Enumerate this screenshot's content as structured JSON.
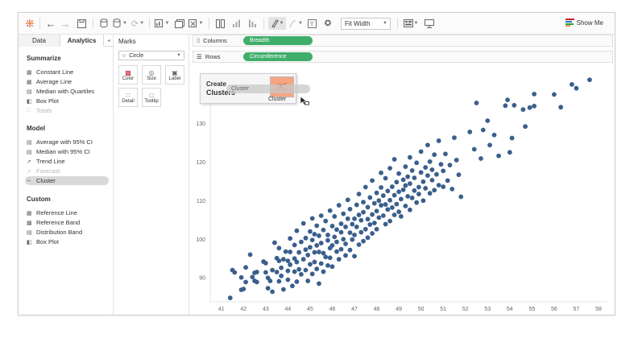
{
  "toolbar": {
    "fit_select": "Fit Width",
    "show_me": "Show Me",
    "icons": [
      "tableau-logo-icon",
      "undo-icon",
      "redo-icon",
      "save-icon",
      "new-datasource-icon",
      "pause-icon",
      "refresh-icon",
      "new-sheet-icon",
      "duplicate-sheet-icon",
      "clear-sheet-icon",
      "swap-icon",
      "sort-ascending-icon",
      "sort-descending-icon",
      "highlight-icon",
      "group-icon",
      "label-icon",
      "pin-icon",
      "fit-icon",
      "presentation-icon",
      "show-me-icon"
    ]
  },
  "left_panel": {
    "tabs": {
      "data": "Data",
      "analytics": "Analytics",
      "collapse": "◂"
    },
    "summarize": {
      "title": "Summarize",
      "items": [
        {
          "label": "Constant Line",
          "icon": "constant-line-icon",
          "enabled": true
        },
        {
          "label": "Average Line",
          "icon": "average-line-icon",
          "enabled": true
        },
        {
          "label": "Median with Quartiles",
          "icon": "median-quartiles-icon",
          "enabled": true
        },
        {
          "label": "Box Plot",
          "icon": "box-plot-icon",
          "enabled": true
        },
        {
          "label": "Totals",
          "icon": "totals-icon",
          "enabled": false
        }
      ]
    },
    "model": {
      "title": "Model",
      "items": [
        {
          "label": "Average with 95% CI",
          "icon": "average-ci-icon",
          "enabled": true
        },
        {
          "label": "Median with 95% CI",
          "icon": "median-ci-icon",
          "enabled": true
        },
        {
          "label": "Trend Line",
          "icon": "trend-line-icon",
          "enabled": true
        },
        {
          "label": "Forecast",
          "icon": "forecast-icon",
          "enabled": false
        },
        {
          "label": "Cluster",
          "icon": "cluster-icon",
          "enabled": true,
          "selected": true
        }
      ]
    },
    "custom": {
      "title": "Custom",
      "items": [
        {
          "label": "Reference Line",
          "icon": "reference-line-icon",
          "enabled": true
        },
        {
          "label": "Reference Band",
          "icon": "reference-band-icon",
          "enabled": true
        },
        {
          "label": "Distribution Band",
          "icon": "distribution-band-icon",
          "enabled": true
        },
        {
          "label": "Box Plot",
          "icon": "box-plot-icon",
          "enabled": true
        }
      ]
    }
  },
  "marks": {
    "title": "Marks",
    "type": "Circle",
    "cards": [
      "Color",
      "Size",
      "Label",
      "Detail",
      "Tooltip"
    ]
  },
  "shelves": {
    "columns_label": "Columns",
    "columns_pill": "Breadth",
    "rows_label": "Rows",
    "rows_pill": "Circumference"
  },
  "overlay": {
    "title_line1": "Create",
    "title_line2": "Clusters",
    "drop_label": "Cluster",
    "drag_ghost": "Cluster"
  },
  "colors": {
    "accent_pill": "#3fae6a",
    "mark": "#3b5f8c",
    "drop_target": "#f6a583"
  },
  "chart_data": {
    "type": "scatter",
    "x_ticks": [
      41,
      42,
      43,
      44,
      45,
      46,
      47,
      48,
      49,
      50,
      51,
      52,
      53,
      54,
      55,
      56,
      57,
      58
    ],
    "y_ticks": [
      90,
      100,
      110,
      120,
      130
    ],
    "xlim": [
      40.5,
      58.4
    ],
    "ylim": [
      84,
      143
    ],
    "grid": false,
    "points": [
      [
        41.4,
        84.8
      ],
      [
        41.5,
        92.0
      ],
      [
        41.6,
        91.4
      ],
      [
        41.9,
        90.1
      ],
      [
        41.9,
        86.9
      ],
      [
        42.0,
        87.1
      ],
      [
        42.1,
        88.9
      ],
      [
        42.1,
        92.7
      ],
      [
        42.3,
        96.0
      ],
      [
        42.4,
        90.2
      ],
      [
        42.5,
        89.2
      ],
      [
        42.5,
        91.3
      ],
      [
        42.6,
        88.9
      ],
      [
        42.6,
        91.5
      ],
      [
        42.9,
        94.2
      ],
      [
        43.0,
        93.8
      ],
      [
        43.0,
        91.4
      ],
      [
        43.1,
        90.0
      ],
      [
        43.1,
        87.3
      ],
      [
        43.2,
        89.2
      ],
      [
        43.3,
        92.0
      ],
      [
        43.3,
        86.4
      ],
      [
        43.4,
        99.1
      ],
      [
        43.5,
        91.5
      ],
      [
        43.5,
        95.1
      ],
      [
        43.6,
        89.1
      ],
      [
        43.6,
        97.7
      ],
      [
        43.6,
        94.4
      ],
      [
        43.7,
        92.6
      ],
      [
        43.7,
        90.5
      ],
      [
        43.8,
        94.8
      ],
      [
        43.8,
        87.0
      ],
      [
        43.9,
        96.8
      ],
      [
        44.0,
        94.4
      ],
      [
        44.0,
        91.8
      ],
      [
        44.0,
        89.5
      ],
      [
        44.1,
        100.2
      ],
      [
        44.1,
        96.7
      ],
      [
        44.1,
        93.4
      ],
      [
        44.2,
        87.9
      ],
      [
        44.3,
        95.0
      ],
      [
        44.3,
        91.6
      ],
      [
        44.3,
        98.5
      ],
      [
        44.4,
        89.0
      ],
      [
        44.4,
        102.2
      ],
      [
        44.4,
        94.1
      ],
      [
        44.5,
        92.2
      ],
      [
        44.5,
        96.6
      ],
      [
        44.6,
        99.3
      ],
      [
        44.6,
        90.9
      ],
      [
        44.7,
        104.1
      ],
      [
        44.7,
        94.8
      ],
      [
        44.8,
        97.3
      ],
      [
        44.8,
        92.0
      ],
      [
        44.8,
        100.3
      ],
      [
        44.9,
        95.9
      ],
      [
        44.9,
        89.2
      ],
      [
        45.0,
        102.0
      ],
      [
        45.0,
        97.9
      ],
      [
        45.0,
        93.5
      ],
      [
        45.1,
        99.8
      ],
      [
        45.1,
        105.4
      ],
      [
        45.1,
        91.0
      ],
      [
        45.2,
        96.6
      ],
      [
        45.2,
        101.3
      ],
      [
        45.2,
        94.1
      ],
      [
        45.3,
        98.4
      ],
      [
        45.3,
        92.3
      ],
      [
        45.3,
        103.5
      ],
      [
        45.4,
        96.7
      ],
      [
        45.4,
        100.9
      ],
      [
        45.4,
        88.5
      ],
      [
        45.5,
        93.7
      ],
      [
        45.5,
        106.1
      ],
      [
        45.5,
        99.0
      ],
      [
        45.6,
        96.4
      ],
      [
        45.6,
        102.4
      ],
      [
        45.6,
        91.6
      ],
      [
        45.7,
        95.4
      ],
      [
        45.7,
        104.7
      ],
      [
        45.8,
        99.7
      ],
      [
        45.8,
        93.2
      ],
      [
        45.8,
        101.1
      ],
      [
        45.9,
        97.7
      ],
      [
        45.9,
        107.4
      ],
      [
        45.9,
        95.2
      ],
      [
        46.0,
        103.4
      ],
      [
        46.0,
        98.4
      ],
      [
        46.0,
        92.9
      ],
      [
        46.1,
        100.6
      ],
      [
        46.1,
        105.9
      ],
      [
        46.2,
        96.8
      ],
      [
        46.2,
        102.5
      ],
      [
        46.2,
        99.3
      ],
      [
        46.3,
        108.8
      ],
      [
        46.3,
        94.8
      ],
      [
        46.4,
        101.8
      ],
      [
        46.4,
        104.0
      ],
      [
        46.4,
        97.4
      ],
      [
        46.5,
        106.6
      ],
      [
        46.5,
        100.0
      ],
      [
        46.6,
        95.8
      ],
      [
        46.6,
        103.2
      ],
      [
        46.6,
        98.8
      ],
      [
        46.7,
        110.2
      ],
      [
        46.7,
        105.3
      ],
      [
        46.8,
        101.7
      ],
      [
        46.8,
        97.2
      ],
      [
        46.8,
        107.8
      ],
      [
        46.9,
        103.9
      ],
      [
        46.9,
        99.9
      ],
      [
        47.0,
        95.6
      ],
      [
        47.0,
        105.3
      ],
      [
        47.0,
        101.1
      ],
      [
        47.1,
        108.9
      ],
      [
        47.1,
        103.2
      ],
      [
        47.2,
        98.6
      ],
      [
        47.2,
        106.3
      ],
      [
        47.2,
        111.7
      ],
      [
        47.3,
        101.8
      ],
      [
        47.3,
        104.9
      ],
      [
        47.4,
        99.5
      ],
      [
        47.4,
        109.6
      ],
      [
        47.4,
        107.0
      ],
      [
        47.5,
        102.6
      ],
      [
        47.5,
        113.5
      ],
      [
        47.6,
        105.2
      ],
      [
        47.6,
        100.4
      ],
      [
        47.6,
        108.3
      ],
      [
        47.7,
        103.8
      ],
      [
        47.7,
        110.8
      ],
      [
        47.8,
        106.4
      ],
      [
        47.8,
        101.5
      ],
      [
        47.8,
        115.2
      ],
      [
        47.9,
        109.3
      ],
      [
        47.9,
        104.2
      ],
      [
        48.0,
        107.3
      ],
      [
        48.0,
        112.0
      ],
      [
        48.0,
        102.6
      ],
      [
        48.1,
        110.0
      ],
      [
        48.1,
        105.6
      ],
      [
        48.2,
        117.2
      ],
      [
        48.2,
        108.8
      ],
      [
        48.2,
        113.4
      ],
      [
        48.3,
        106.1
      ],
      [
        48.3,
        111.3
      ],
      [
        48.4,
        103.9
      ],
      [
        48.4,
        109.0
      ],
      [
        48.4,
        115.8
      ],
      [
        48.5,
        107.7
      ],
      [
        48.5,
        112.5
      ],
      [
        48.6,
        104.7
      ],
      [
        48.6,
        118.4
      ],
      [
        48.6,
        110.1
      ],
      [
        48.7,
        108.2
      ],
      [
        48.7,
        113.6
      ],
      [
        48.8,
        106.3
      ],
      [
        48.8,
        111.4
      ],
      [
        48.8,
        120.7
      ],
      [
        48.9,
        109.1
      ],
      [
        48.9,
        114.8
      ],
      [
        49.0,
        107.1
      ],
      [
        49.0,
        112.3
      ],
      [
        49.0,
        117.0
      ],
      [
        49.1,
        110.4
      ],
      [
        49.1,
        105.9
      ],
      [
        49.2,
        115.4
      ],
      [
        49.2,
        112.8
      ],
      [
        49.3,
        108.6
      ],
      [
        49.3,
        118.8
      ],
      [
        49.3,
        113.9
      ],
      [
        49.4,
        111.1
      ],
      [
        49.4,
        116.2
      ],
      [
        49.5,
        107.6
      ],
      [
        49.5,
        114.4
      ],
      [
        49.5,
        121.2
      ],
      [
        49.6,
        110.7
      ],
      [
        49.6,
        117.8
      ],
      [
        49.7,
        112.6
      ],
      [
        49.7,
        115.9
      ],
      [
        49.8,
        109.5
      ],
      [
        49.8,
        119.8
      ],
      [
        49.9,
        113.5
      ],
      [
        49.9,
        111.7
      ],
      [
        50.0,
        117.3
      ],
      [
        50.0,
        122.7
      ],
      [
        50.1,
        114.9
      ],
      [
        50.1,
        110.0
      ],
      [
        50.2,
        118.6
      ],
      [
        50.2,
        113.2
      ],
      [
        50.3,
        116.5
      ],
      [
        50.3,
        124.4
      ],
      [
        50.4,
        111.9
      ],
      [
        50.4,
        120.1
      ],
      [
        50.5,
        115.3
      ],
      [
        50.5,
        118.0
      ],
      [
        50.6,
        112.7
      ],
      [
        50.6,
        121.9
      ],
      [
        50.7,
        116.8
      ],
      [
        50.8,
        114.0
      ],
      [
        50.8,
        125.5
      ],
      [
        50.9,
        119.4
      ],
      [
        51.0,
        113.6
      ],
      [
        51.0,
        117.7
      ],
      [
        51.1,
        122.1
      ],
      [
        51.2,
        115.2
      ],
      [
        51.3,
        119.2
      ],
      [
        51.4,
        113.0
      ],
      [
        51.5,
        126.3
      ],
      [
        51.6,
        120.5
      ],
      [
        51.7,
        116.7
      ],
      [
        51.8,
        111.0
      ],
      [
        52.2,
        127.8
      ],
      [
        52.4,
        123.3
      ],
      [
        52.5,
        135.3
      ],
      [
        52.7,
        120.9
      ],
      [
        52.8,
        128.3
      ],
      [
        53.0,
        130.7
      ],
      [
        53.1,
        124.4
      ],
      [
        53.3,
        127.0
      ],
      [
        53.5,
        121.6
      ],
      [
        53.8,
        134.6
      ],
      [
        53.9,
        136.1
      ],
      [
        54.0,
        122.5
      ],
      [
        54.1,
        126.2
      ],
      [
        54.1,
        146.4
      ],
      [
        54.2,
        134.7
      ],
      [
        54.6,
        133.6
      ],
      [
        54.7,
        129.2
      ],
      [
        54.9,
        134.1
      ],
      [
        55.1,
        137.6
      ],
      [
        55.1,
        134.5
      ],
      [
        56.0,
        137.5
      ],
      [
        56.3,
        134.2
      ],
      [
        56.8,
        140.1
      ],
      [
        57.0,
        139.1
      ],
      [
        57.6,
        141.3
      ]
    ]
  }
}
